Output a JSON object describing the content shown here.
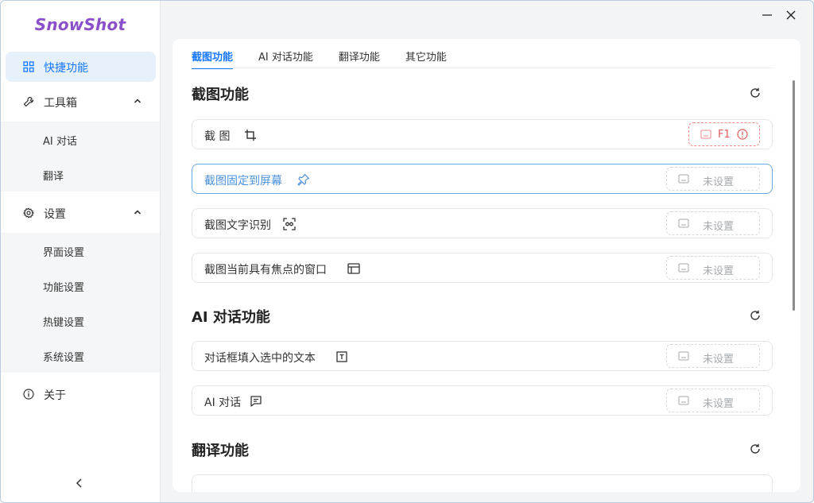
{
  "app": {
    "name": "SnowShot"
  },
  "sidebar": {
    "items": [
      {
        "label": "快捷功能",
        "icon": "grid-icon",
        "active": true
      },
      {
        "label": "工具箱",
        "icon": "wrench-icon",
        "expanded": true,
        "children": [
          {
            "label": "AI 对话"
          },
          {
            "label": "翻译"
          }
        ]
      },
      {
        "label": "设置",
        "icon": "gear-icon",
        "expanded": true,
        "children": [
          {
            "label": "界面设置"
          },
          {
            "label": "功能设置"
          },
          {
            "label": "热键设置"
          },
          {
            "label": "系统设置"
          }
        ]
      },
      {
        "label": "关于",
        "icon": "info-icon"
      }
    ]
  },
  "tabs": [
    {
      "label": "截图功能",
      "active": true
    },
    {
      "label": "AI 对话功能"
    },
    {
      "label": "翻译功能"
    },
    {
      "label": "其它功能"
    }
  ],
  "sections": [
    {
      "title": "截图功能",
      "rows": [
        {
          "label": "截 图",
          "icon": "crop-icon",
          "hotkey": "F1"
        },
        {
          "label": "截图固定到屏幕",
          "icon": "pin-icon",
          "hotkey": "未设置"
        },
        {
          "label": "截图文字识别",
          "icon": "ocr-icon",
          "hotkey": "未设置"
        },
        {
          "label": "截图当前具有焦点的窗口",
          "icon": "window-icon",
          "hotkey": "未设置"
        }
      ]
    },
    {
      "title": "AI 对话功能",
      "rows": [
        {
          "label": "对话框填入选中的文本",
          "icon": "text-select-icon",
          "hotkey": "未设置"
        },
        {
          "label": "AI 对话",
          "icon": "chat-icon",
          "hotkey": "未设置"
        }
      ]
    },
    {
      "title": "翻译功能",
      "rows": []
    }
  ],
  "colors": {
    "accent": "#1677ff",
    "brand": "#8a4fc9",
    "error": "#e25d5d"
  }
}
